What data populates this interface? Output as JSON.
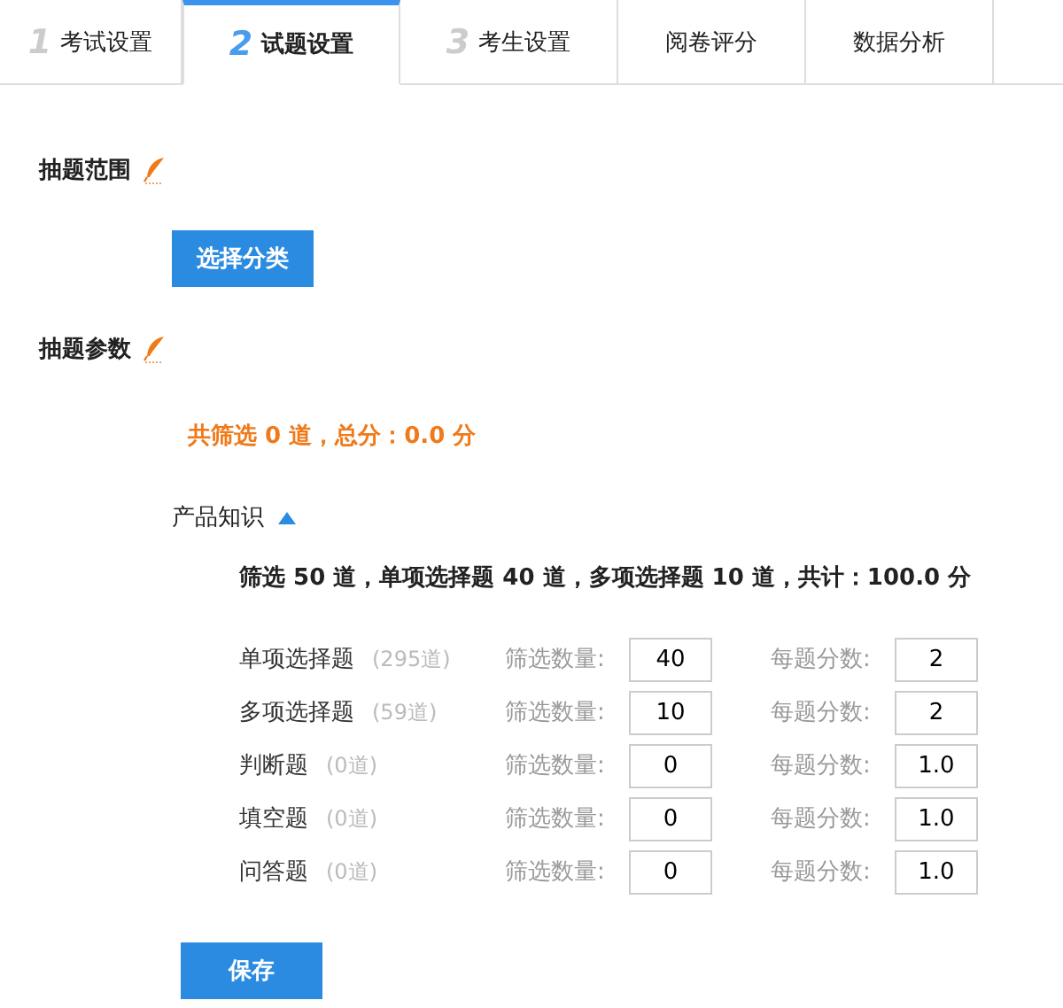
{
  "tabs": [
    {
      "number": "1",
      "label": "考试设置",
      "selected": false
    },
    {
      "number": "2",
      "label": "试题设置",
      "selected": true
    },
    {
      "number": "3",
      "label": "考生设置",
      "selected": false
    },
    {
      "label": "阅卷评分",
      "selected": false
    },
    {
      "label": "数据分析",
      "selected": false
    }
  ],
  "scope": {
    "title": "抽题范围",
    "button": "选择分类"
  },
  "params": {
    "title": "抽题参数",
    "summary": "共筛选 0 道，总分：0.0 分",
    "category": {
      "name": "产品知识",
      "expanded": true,
      "summary": "筛选 50 道，单项选择题 40 道，多项选择题 10 道，共计：100.0 分",
      "rows": [
        {
          "type": "单项选择题",
          "count": "(295道)",
          "count_label": "筛选数量:",
          "count_value": "40",
          "score_label": "每题分数:",
          "score_value": "2"
        },
        {
          "type": "多项选择题",
          "count": "(59道)",
          "count_label": "筛选数量:",
          "count_value": "10",
          "score_label": "每题分数:",
          "score_value": "2"
        },
        {
          "type": "判断题",
          "count": "(0道)",
          "count_label": "筛选数量:",
          "count_value": "0",
          "score_label": "每题分数:",
          "score_value": "1.0"
        },
        {
          "type": "填空题",
          "count": "(0道)",
          "count_label": "筛选数量:",
          "count_value": "0",
          "score_label": "每题分数:",
          "score_value": "1.0"
        },
        {
          "type": "问答题",
          "count": "(0道)",
          "count_label": "筛选数量:",
          "count_value": "0",
          "score_label": "每题分数:",
          "score_value": "1.0"
        }
      ]
    }
  },
  "save_button": "保存"
}
